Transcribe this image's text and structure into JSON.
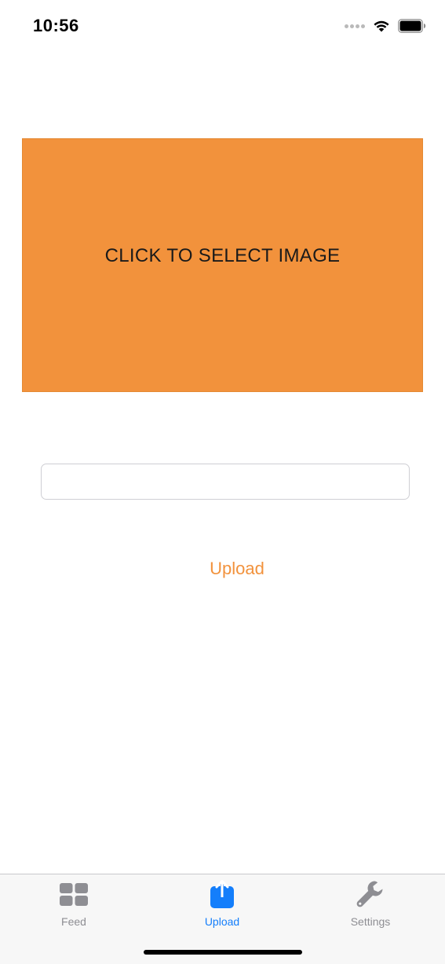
{
  "status_bar": {
    "time": "10:56"
  },
  "image_select": {
    "label": "CLICK TO SELECT IMAGE",
    "color": "#f2923c"
  },
  "caption_field": {
    "value": "",
    "placeholder": ""
  },
  "upload_button": {
    "label": "Upload",
    "color": "#f2923c"
  },
  "tab_bar": {
    "active": "Upload",
    "active_color": "#147efb",
    "inactive_color": "#8e8e93",
    "tabs": [
      {
        "label": "Feed",
        "icon": "grid-icon"
      },
      {
        "label": "Upload",
        "icon": "upload-icon"
      },
      {
        "label": "Settings",
        "icon": "wrench-icon"
      }
    ]
  }
}
